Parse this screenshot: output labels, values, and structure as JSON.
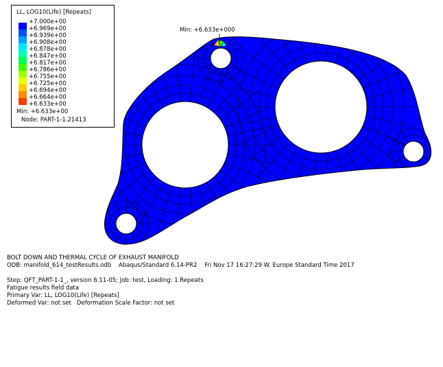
{
  "legend": {
    "title": "LL, LOG10(Life) [Repeats]",
    "labels": [
      "+7.000e+00",
      "+6.969e+00",
      "+6.939e+00",
      "+6.908e+00",
      "+6.878e+00",
      "+6.847e+00",
      "+6.817e+00",
      "+6.786e+00",
      "+6.755e+00",
      "+6.725e+00",
      "+6.694e+00",
      "+6.664e+00",
      "+6.633e+00"
    ],
    "colors": [
      "#0000ff",
      "#0050ff",
      "#00a0ff",
      "#00e6ff",
      "#00ffb4",
      "#00ff50",
      "#3cff00",
      "#a0ff00",
      "#e6ff00",
      "#ffc800",
      "#ff8c00",
      "#ff3c00"
    ],
    "min_label": "Min: +6.633e+00",
    "node_label": "Node: PART-1-1.21413"
  },
  "viewport": {
    "min_annotation": "Min: +6.633e+000",
    "part_color": "#0000ff",
    "mesh_color": "#000000",
    "hotspot_colors": [
      "#ffc800",
      "#3cff00",
      "#00e6ff"
    ]
  },
  "info": {
    "title": "BOLT DOWN AND THERMAL CYCLE OF EXHAUST MANIFOLD",
    "odb": "ODB: manifold_614_testResults.odb    Abaqus/Standard 6.14-PR2    Fri Nov 17 16:27:29 W. Europe Standard Time 2017",
    "step": "Step: QFT_PART-1-1_, version 6.11-05; Job: test, Loading: 1 Repeats",
    "field": "Fatigue results field data",
    "primary": "Primary Var: LL, LOG10(Life) [Repeats]",
    "deformed": "Deformed Var: not set   Deformation Scale Factor: not set"
  }
}
